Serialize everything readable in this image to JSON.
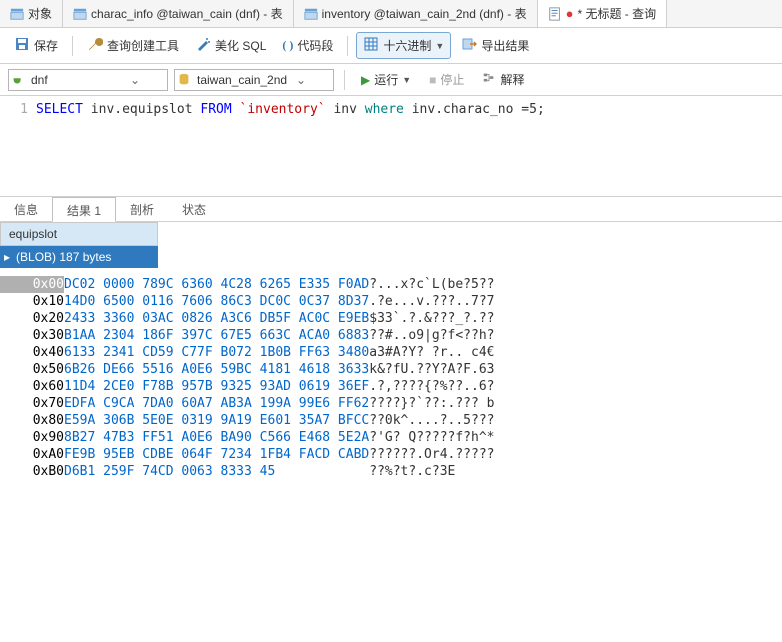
{
  "tabs": {
    "t0": "对象",
    "t1": "charac_info @taiwan_cain (dnf) - 表",
    "t2": "inventory @taiwan_cain_2nd (dnf) - 表",
    "t3": "* 无标题 - 查询"
  },
  "toolbar": {
    "save": "保存",
    "queryBuilder": "查询创建工具",
    "beautify": "美化 SQL",
    "snippet": "代码段",
    "hex": "十六进制",
    "export": "导出结果"
  },
  "conn": {
    "db1": "dnf",
    "db2": "taiwan_cain_2nd",
    "run": "运行",
    "stop": "停止",
    "explain": "解释"
  },
  "sql": {
    "line": "1",
    "select": "SELECT",
    "col": " inv.equipslot ",
    "from": "FROM",
    "tbl": " `inventory` ",
    "alias": "inv ",
    "where": "where",
    "rest": " inv.charac_no =5;"
  },
  "rtabs": {
    "info": "信息",
    "res": "结果 1",
    "profile": "剖析",
    "status": "状态"
  },
  "grid": {
    "col": "equipslot",
    "val": "(BLOB) 187 bytes"
  },
  "hex": [
    {
      "off": "0x00",
      "b": "DC02 0000 789C 6360 4C28 6265 E335 F0AD",
      "a": "?...x?c`L(be?5??"
    },
    {
      "off": "0x10",
      "b": "14D0 6500 0116 7606 86C3 DC0C 0C37 8D37",
      "a": ".?e...v.???..7?7"
    },
    {
      "off": "0x20",
      "b": "2433 3360 03AC 0826 A3C6 DB5F AC0C E9EB",
      "a": "$33`.?.&???_?.??"
    },
    {
      "off": "0x30",
      "b": "B1AA 2304 186F 397C 67E5 663C ACA0 6883",
      "a": "??#..o9|g?f<??h?"
    },
    {
      "off": "0x40",
      "b": "6133 2341 CD59 C77F B072 1B0B FF63 3480",
      "a": "a3#A?Y? ?r.. c4€"
    },
    {
      "off": "0x50",
      "b": "6B26 DE66 5516 A0E6 59BC 4181 4618 3633",
      "a": "k&?fU.??Y?A?F.63"
    },
    {
      "off": "0x60",
      "b": "11D4 2CE0 F78B 957B 9325 93AD 0619 36EF",
      "a": ".?,????{?%??..6?"
    },
    {
      "off": "0x70",
      "b": "EDFA C9CA 7DA0 60A7 AB3A 199A 99E6 FF62",
      "a": "????}?`??:.??? b"
    },
    {
      "off": "0x80",
      "b": "E59A 306B 5E0E 0319 9A19 E601 35A7 BFCC",
      "a": "??0k^....?..5???"
    },
    {
      "off": "0x90",
      "b": "8B27 47B3 FF51 A0E6 BA90 C566 E468 5E2A",
      "a": "?'G? Q?????f?h^*"
    },
    {
      "off": "0xA0",
      "b": "FE9B 95EB CDBE 064F 7234 1FB4 FACD CABD",
      "a": "??????.Or4.?????"
    },
    {
      "off": "0xB0",
      "b": "D6B1 259F 74CD 0063 8333 45",
      "a": "??%?t?.c?3E"
    }
  ]
}
